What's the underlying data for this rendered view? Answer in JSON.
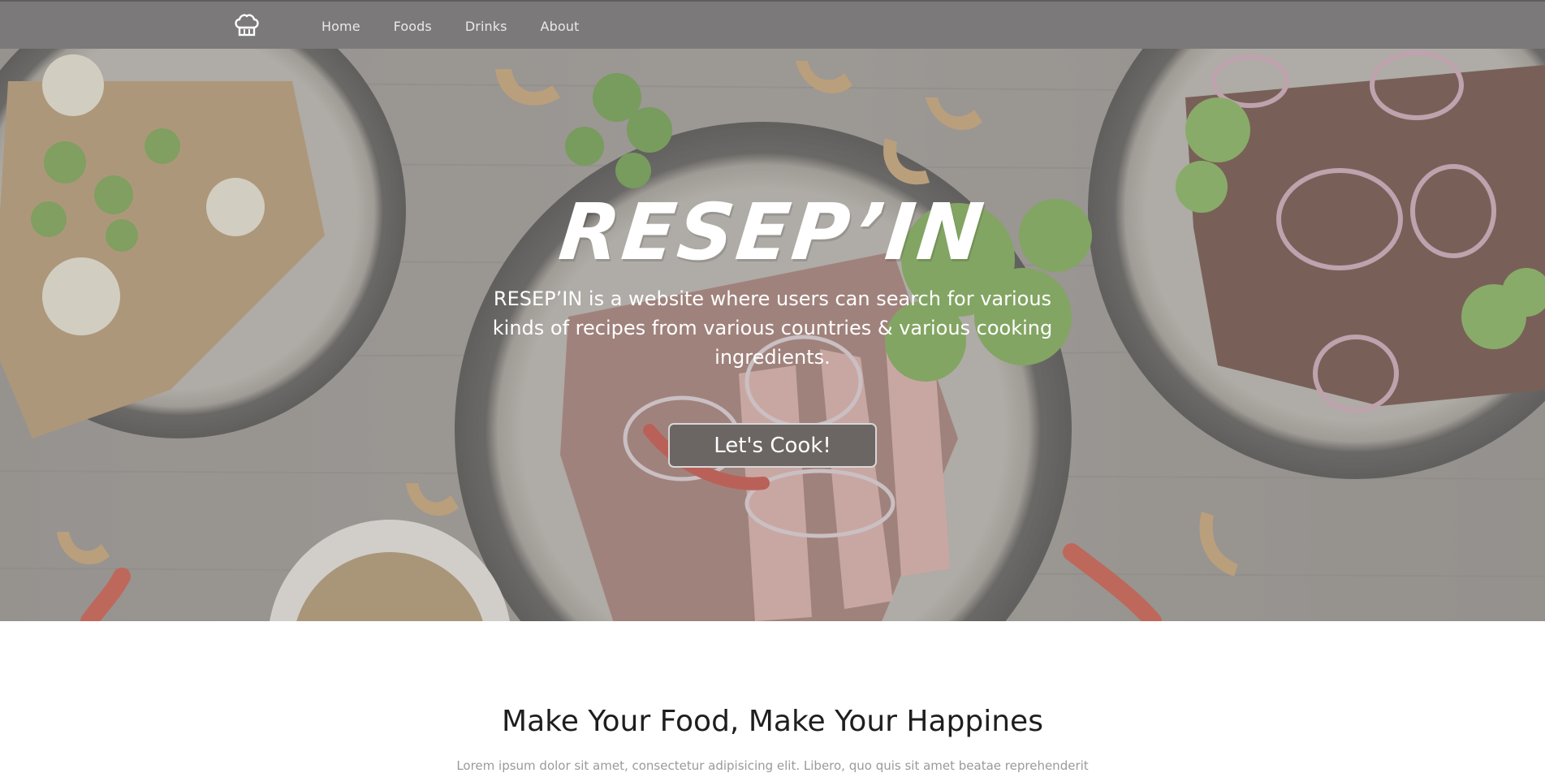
{
  "nav": {
    "brand_icon": "chef-hat-icon",
    "links": [
      {
        "label": "Home"
      },
      {
        "label": "Foods"
      },
      {
        "label": "Drinks"
      },
      {
        "label": "About"
      }
    ]
  },
  "hero": {
    "title": "RESEP’IN",
    "description": "RESEP’IN is a website where users can search for various kinds of recipes from various countries & various cooking ingredients.",
    "cta_label": "Let's Cook!"
  },
  "section": {
    "title": "Make Your Food, Make Your Happines",
    "text": "Lorem ipsum dolor sit amet, consectetur adipisicing elit. Libero, quo quis sit amet beatae reprehenderit"
  },
  "colors": {
    "navbar": "#7b7979",
    "button_bg": "#6b6664",
    "hero_text": "#ffffff",
    "section_title": "#1e1e1e"
  }
}
